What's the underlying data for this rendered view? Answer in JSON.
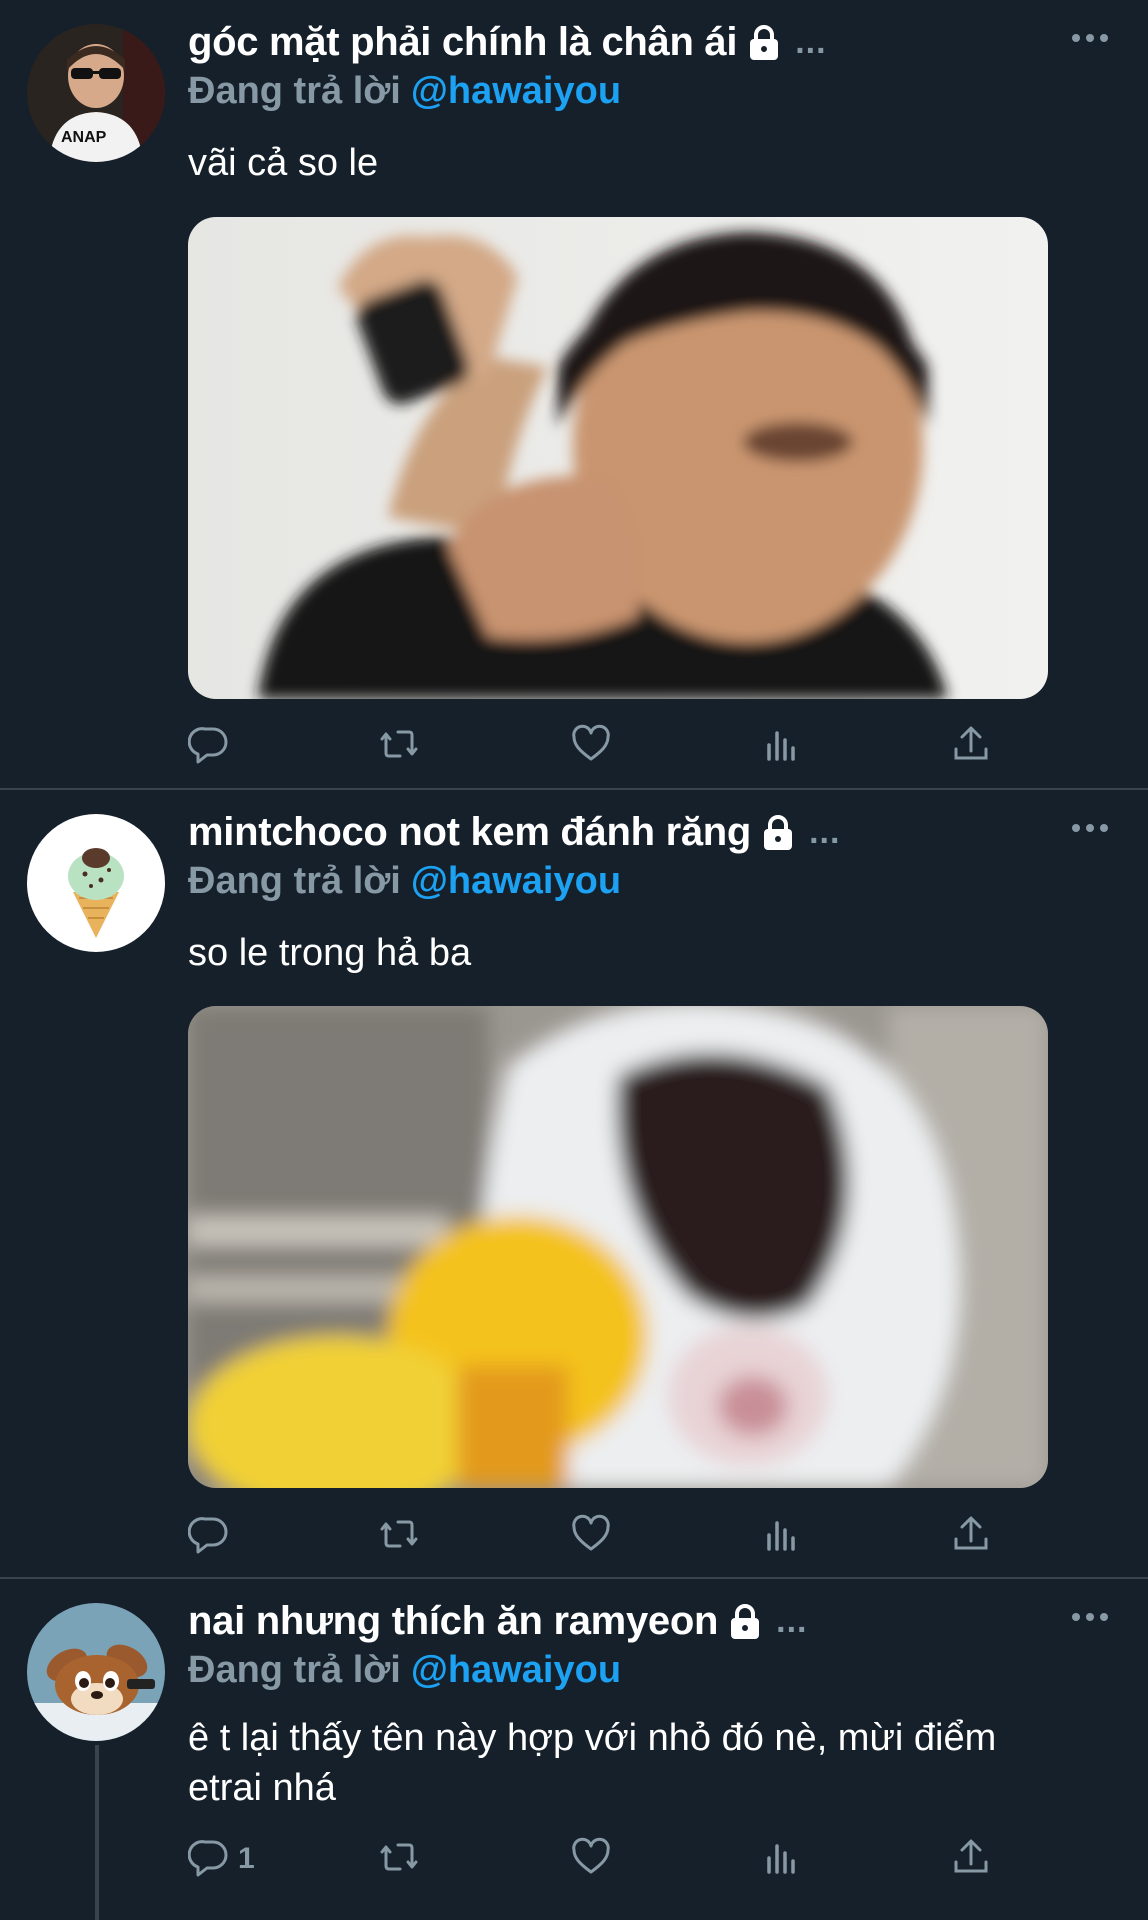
{
  "tweets": [
    {
      "name": "góc mặt phải chính là chân ái",
      "reply_prefix": "Đang trả lời",
      "reply_handle": "@hawaiyou",
      "text": "vãi cả so le",
      "reply_count": "",
      "avatar": "avatar-boy-sunglasses"
    },
    {
      "name": "mintchoco not kem đánh răng",
      "reply_prefix": "Đang trả lời",
      "reply_handle": "@hawaiyou",
      "text": "so le trong hả ba",
      "reply_count": "",
      "avatar": "avatar-mint-ice-cream"
    },
    {
      "name": "nai nhưng thích ăn ramyeon",
      "reply_prefix": "Đang trả lời",
      "reply_handle": "@hawaiyou",
      "text": "ê t lại thấy tên này hợp với nhỏ đó nè, mừi điểm etrai nhá",
      "reply_count": "1",
      "avatar": "avatar-cartoon-deer"
    }
  ],
  "overflow_indicator": "...",
  "icons": [
    "reply-icon",
    "retweet-icon",
    "like-icon",
    "analytics-icon",
    "share-icon",
    "more-icon",
    "lock-icon"
  ],
  "colors": {
    "background": "#15202b",
    "divider": "#38444d",
    "secondary": "#8899a6",
    "accent": "#1da1f2"
  }
}
